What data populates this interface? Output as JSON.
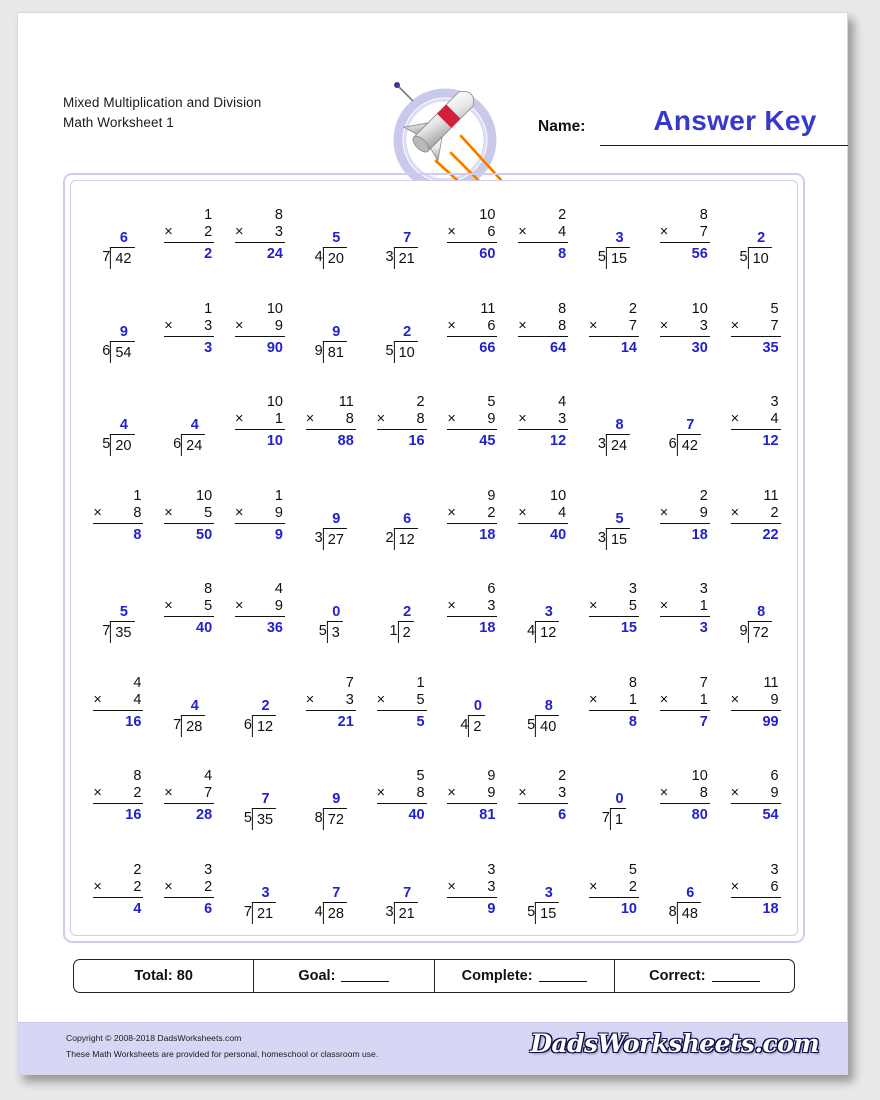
{
  "document": {
    "title_line1": "Mixed Multiplication and Division",
    "title_line2": "Math Worksheet 1"
  },
  "header": {
    "name_label": "Name:",
    "answer_key": "Answer Key",
    "logo_icon": "rocket-icon",
    "accent_color": "#3838cc",
    "answer_color": "#2222cc"
  },
  "totals": {
    "total": "Total: 80",
    "goal": "Goal:",
    "complete": "Complete:",
    "correct": "Correct:"
  },
  "footer": {
    "copyright": "Copyright © 2008-2018 DadsWorksheets.com",
    "usage": "These Math Worksheets are provided for personal, homeschool or classroom use.",
    "brand": "DadsWorksheets.com"
  },
  "problems": [
    {
      "type": "div",
      "divisor": "7",
      "dividend": "42",
      "answer": "6"
    },
    {
      "type": "mul",
      "top": "1",
      "sign": "×",
      "bottom": "2",
      "answer": "2"
    },
    {
      "type": "mul",
      "top": "8",
      "sign": "×",
      "bottom": "3",
      "answer": "24"
    },
    {
      "type": "div",
      "divisor": "4",
      "dividend": "20",
      "answer": "5"
    },
    {
      "type": "div",
      "divisor": "3",
      "dividend": "21",
      "answer": "7"
    },
    {
      "type": "mul",
      "top": "10",
      "sign": "×",
      "bottom": "6",
      "answer": "60"
    },
    {
      "type": "mul",
      "top": "2",
      "sign": "×",
      "bottom": "4",
      "answer": "8"
    },
    {
      "type": "div",
      "divisor": "5",
      "dividend": "15",
      "answer": "3"
    },
    {
      "type": "mul",
      "top": "8",
      "sign": "×",
      "bottom": "7",
      "answer": "56"
    },
    {
      "type": "div",
      "divisor": "5",
      "dividend": "10",
      "answer": "2"
    },
    {
      "type": "div",
      "divisor": "6",
      "dividend": "54",
      "answer": "9"
    },
    {
      "type": "mul",
      "top": "1",
      "sign": "×",
      "bottom": "3",
      "answer": "3"
    },
    {
      "type": "mul",
      "top": "10",
      "sign": "×",
      "bottom": "9",
      "answer": "90"
    },
    {
      "type": "div",
      "divisor": "9",
      "dividend": "81",
      "answer": "9"
    },
    {
      "type": "div",
      "divisor": "5",
      "dividend": "10",
      "answer": "2"
    },
    {
      "type": "mul",
      "top": "11",
      "sign": "×",
      "bottom": "6",
      "answer": "66"
    },
    {
      "type": "mul",
      "top": "8",
      "sign": "×",
      "bottom": "8",
      "answer": "64"
    },
    {
      "type": "mul",
      "top": "2",
      "sign": "×",
      "bottom": "7",
      "answer": "14"
    },
    {
      "type": "mul",
      "top": "10",
      "sign": "×",
      "bottom": "3",
      "answer": "30"
    },
    {
      "type": "mul",
      "top": "5",
      "sign": "×",
      "bottom": "7",
      "answer": "35"
    },
    {
      "type": "div",
      "divisor": "5",
      "dividend": "20",
      "answer": "4"
    },
    {
      "type": "div",
      "divisor": "6",
      "dividend": "24",
      "answer": "4"
    },
    {
      "type": "mul",
      "top": "10",
      "sign": "×",
      "bottom": "1",
      "answer": "10"
    },
    {
      "type": "mul",
      "top": "11",
      "sign": "×",
      "bottom": "8",
      "answer": "88"
    },
    {
      "type": "mul",
      "top": "2",
      "sign": "×",
      "bottom": "8",
      "answer": "16"
    },
    {
      "type": "mul",
      "top": "5",
      "sign": "×",
      "bottom": "9",
      "answer": "45"
    },
    {
      "type": "mul",
      "top": "4",
      "sign": "×",
      "bottom": "3",
      "answer": "12"
    },
    {
      "type": "div",
      "divisor": "3",
      "dividend": "24",
      "answer": "8"
    },
    {
      "type": "div",
      "divisor": "6",
      "dividend": "42",
      "answer": "7"
    },
    {
      "type": "mul",
      "top": "3",
      "sign": "×",
      "bottom": "4",
      "answer": "12"
    },
    {
      "type": "mul",
      "top": "1",
      "sign": "×",
      "bottom": "8",
      "answer": "8"
    },
    {
      "type": "mul",
      "top": "10",
      "sign": "×",
      "bottom": "5",
      "answer": "50"
    },
    {
      "type": "mul",
      "top": "1",
      "sign": "×",
      "bottom": "9",
      "answer": "9"
    },
    {
      "type": "div",
      "divisor": "3",
      "dividend": "27",
      "answer": "9"
    },
    {
      "type": "div",
      "divisor": "2",
      "dividend": "12",
      "answer": "6"
    },
    {
      "type": "mul",
      "top": "9",
      "sign": "×",
      "bottom": "2",
      "answer": "18"
    },
    {
      "type": "mul",
      "top": "10",
      "sign": "×",
      "bottom": "4",
      "answer": "40"
    },
    {
      "type": "div",
      "divisor": "3",
      "dividend": "15",
      "answer": "5"
    },
    {
      "type": "mul",
      "top": "2",
      "sign": "×",
      "bottom": "9",
      "answer": "18"
    },
    {
      "type": "mul",
      "top": "11",
      "sign": "×",
      "bottom": "2",
      "answer": "22"
    },
    {
      "type": "div",
      "divisor": "7",
      "dividend": "35",
      "answer": "5"
    },
    {
      "type": "mul",
      "top": "8",
      "sign": "×",
      "bottom": "5",
      "answer": "40"
    },
    {
      "type": "mul",
      "top": "4",
      "sign": "×",
      "bottom": "9",
      "answer": "36"
    },
    {
      "type": "div",
      "divisor": "5",
      "dividend": "3",
      "answer": "0"
    },
    {
      "type": "div",
      "divisor": "1",
      "dividend": "2",
      "answer": "2"
    },
    {
      "type": "mul",
      "top": "6",
      "sign": "×",
      "bottom": "3",
      "answer": "18"
    },
    {
      "type": "div",
      "divisor": "4",
      "dividend": "12",
      "answer": "3"
    },
    {
      "type": "mul",
      "top": "3",
      "sign": "×",
      "bottom": "5",
      "answer": "15"
    },
    {
      "type": "mul",
      "top": "3",
      "sign": "×",
      "bottom": "1",
      "answer": "3"
    },
    {
      "type": "div",
      "divisor": "9",
      "dividend": "72",
      "answer": "8"
    },
    {
      "type": "mul",
      "top": "4",
      "sign": "×",
      "bottom": "4",
      "answer": "16"
    },
    {
      "type": "div",
      "divisor": "7",
      "dividend": "28",
      "answer": "4"
    },
    {
      "type": "div",
      "divisor": "6",
      "dividend": "12",
      "answer": "2"
    },
    {
      "type": "mul",
      "top": "7",
      "sign": "×",
      "bottom": "3",
      "answer": "21"
    },
    {
      "type": "mul",
      "top": "1",
      "sign": "×",
      "bottom": "5",
      "answer": "5"
    },
    {
      "type": "div",
      "divisor": "4",
      "dividend": "2",
      "answer": "0"
    },
    {
      "type": "div",
      "divisor": "5",
      "dividend": "40",
      "answer": "8"
    },
    {
      "type": "mul",
      "top": "8",
      "sign": "×",
      "bottom": "1",
      "answer": "8"
    },
    {
      "type": "mul",
      "top": "7",
      "sign": "×",
      "bottom": "1",
      "answer": "7"
    },
    {
      "type": "mul",
      "top": "11",
      "sign": "×",
      "bottom": "9",
      "answer": "99"
    },
    {
      "type": "mul",
      "top": "8",
      "sign": "×",
      "bottom": "2",
      "answer": "16"
    },
    {
      "type": "mul",
      "top": "4",
      "sign": "×",
      "bottom": "7",
      "answer": "28"
    },
    {
      "type": "div",
      "divisor": "5",
      "dividend": "35",
      "answer": "7"
    },
    {
      "type": "div",
      "divisor": "8",
      "dividend": "72",
      "answer": "9"
    },
    {
      "type": "mul",
      "top": "5",
      "sign": "×",
      "bottom": "8",
      "answer": "40"
    },
    {
      "type": "mul",
      "top": "9",
      "sign": "×",
      "bottom": "9",
      "answer": "81"
    },
    {
      "type": "mul",
      "top": "2",
      "sign": "×",
      "bottom": "3",
      "answer": "6"
    },
    {
      "type": "div",
      "divisor": "7",
      "dividend": "1",
      "answer": "0"
    },
    {
      "type": "mul",
      "top": "10",
      "sign": "×",
      "bottom": "8",
      "answer": "80"
    },
    {
      "type": "mul",
      "top": "6",
      "sign": "×",
      "bottom": "9",
      "answer": "54"
    },
    {
      "type": "mul",
      "top": "2",
      "sign": "×",
      "bottom": "2",
      "answer": "4"
    },
    {
      "type": "mul",
      "top": "3",
      "sign": "×",
      "bottom": "2",
      "answer": "6"
    },
    {
      "type": "div",
      "divisor": "7",
      "dividend": "21",
      "answer": "3"
    },
    {
      "type": "div",
      "divisor": "4",
      "dividend": "28",
      "answer": "7"
    },
    {
      "type": "div",
      "divisor": "3",
      "dividend": "21",
      "answer": "7"
    },
    {
      "type": "mul",
      "top": "3",
      "sign": "×",
      "bottom": "3",
      "answer": "9"
    },
    {
      "type": "div",
      "divisor": "5",
      "dividend": "15",
      "answer": "3"
    },
    {
      "type": "mul",
      "top": "5",
      "sign": "×",
      "bottom": "2",
      "answer": "10"
    },
    {
      "type": "div",
      "divisor": "8",
      "dividend": "48",
      "answer": "6"
    },
    {
      "type": "mul",
      "top": "3",
      "sign": "×",
      "bottom": "6",
      "answer": "18"
    }
  ]
}
